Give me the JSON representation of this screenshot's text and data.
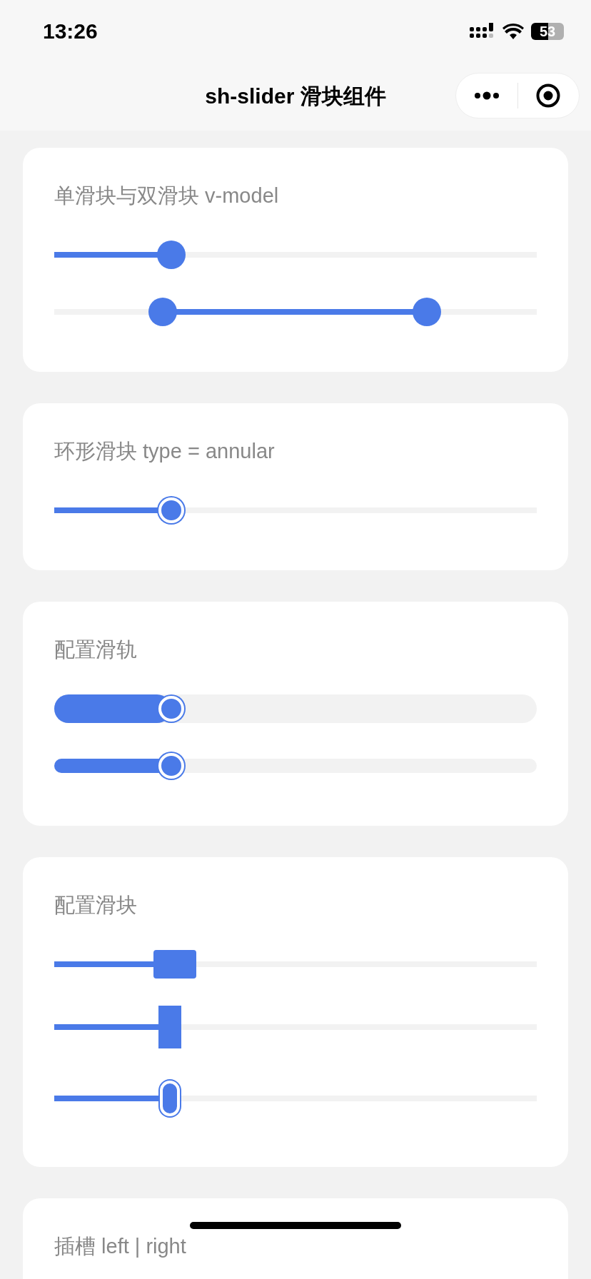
{
  "status_bar": {
    "time": "13:26",
    "battery": "53"
  },
  "nav": {
    "title": "sh-slider 滑块组件"
  },
  "cards": [
    {
      "title": "单滑块与双滑块 v-model",
      "sliders": [
        {
          "kind": "disc",
          "track": {
            "kind": "line"
          },
          "thumbs": [
            {
              "level": 0.243
            }
          ]
        },
        {
          "kind": "disc",
          "track": {
            "kind": "line"
          },
          "thumbs": [
            {
              "level": 0.225
            },
            {
              "level": 0.772
            }
          ]
        }
      ]
    },
    {
      "title": "环形滑块 type = annular",
      "sliders": [
        {
          "kind": "ring",
          "track": {
            "kind": "line"
          },
          "thumbs": [
            {
              "level": 0.243
            }
          ]
        }
      ]
    },
    {
      "title": "配置滑轨",
      "sliders": [
        {
          "kind": "ring",
          "track": {
            "kind": "wide"
          },
          "thumbs": [
            {
              "level": 0.243
            }
          ]
        },
        {
          "kind": "ring",
          "track": {
            "kind": "bar"
          },
          "thumbs": [
            {
              "level": 0.243
            }
          ]
        }
      ]
    },
    {
      "title": "配置滑块",
      "sliders": [
        {
          "kind": "square",
          "track": {
            "kind": "line"
          },
          "thumbs": [
            {
              "level": 0.25
            }
          ]
        },
        {
          "kind": "bar",
          "track": {
            "kind": "line"
          },
          "thumbs": [
            {
              "level": 0.24
            }
          ]
        },
        {
          "kind": "pill",
          "track": {
            "kind": "line"
          },
          "thumbs": [
            {
              "level": 0.24
            }
          ]
        }
      ]
    },
    {
      "title": "插槽 left | right"
    }
  ]
}
